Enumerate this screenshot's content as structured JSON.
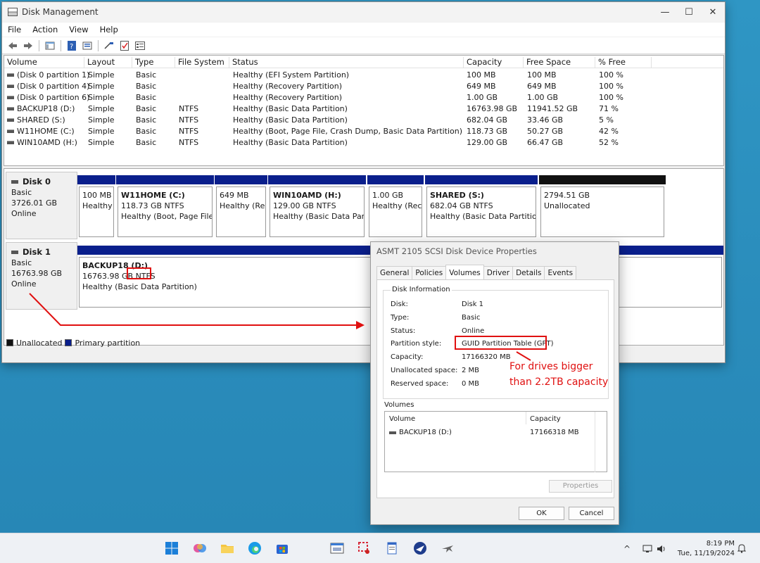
{
  "window": {
    "title": "Disk Management",
    "controls": {
      "minimize": "—",
      "maximize": "☐",
      "close": "✕"
    }
  },
  "menu": [
    "File",
    "Action",
    "View",
    "Help"
  ],
  "toolbar_icons": [
    "back-arrow-icon",
    "forward-arrow-icon",
    "console-tree-icon",
    "help-icon",
    "properties-icon",
    "checklist-icon",
    "details-icon"
  ],
  "volume_list": {
    "headers": [
      "Volume",
      "Layout",
      "Type",
      "File System",
      "Status",
      "Capacity",
      "Free Space",
      "% Free"
    ],
    "rows": [
      [
        "(Disk 0 partition 1)",
        "Simple",
        "Basic",
        "",
        "Healthy (EFI System Partition)",
        "100 MB",
        "100 MB",
        "100 %"
      ],
      [
        "(Disk 0 partition 4)",
        "Simple",
        "Basic",
        "",
        "Healthy (Recovery Partition)",
        "649 MB",
        "649 MB",
        "100 %"
      ],
      [
        "(Disk 0 partition 6)",
        "Simple",
        "Basic",
        "",
        "Healthy (Recovery Partition)",
        "1.00 GB",
        "1.00 GB",
        "100 %"
      ],
      [
        "BACKUP18 (D:)",
        "Simple",
        "Basic",
        "NTFS",
        "Healthy (Basic Data Partition)",
        "16763.98 GB",
        "11941.52 GB",
        "71 %"
      ],
      [
        "SHARED (S:)",
        "Simple",
        "Basic",
        "NTFS",
        "Healthy (Basic Data Partition)",
        "682.04 GB",
        "33.46 GB",
        "5 %"
      ],
      [
        "W11HOME (C:)",
        "Simple",
        "Basic",
        "NTFS",
        "Healthy (Boot, Page File, Crash Dump, Basic Data Partition)",
        "118.73 GB",
        "50.27 GB",
        "42 %"
      ],
      [
        "WIN10AMD (H:)",
        "Simple",
        "Basic",
        "NTFS",
        "Healthy (Basic Data Partition)",
        "129.00 GB",
        "66.47 GB",
        "52 %"
      ]
    ]
  },
  "disk0": {
    "name": "Disk 0",
    "type": "Basic",
    "size": "3726.01 GB",
    "status": "Online",
    "partitions": [
      {
        "name": "",
        "size": "100 MB",
        "status": "Healthy"
      },
      {
        "name": "W11HOME  (C:)",
        "size": "118.73 GB NTFS",
        "status": "Healthy (Boot, Page File,"
      },
      {
        "name": "",
        "size": "649 MB",
        "status": "Healthy (Rec"
      },
      {
        "name": "WIN10AMD  (H:)",
        "size": "129.00 GB NTFS",
        "status": "Healthy (Basic Data Parti"
      },
      {
        "name": "",
        "size": "1.00 GB",
        "status": "Healthy (Recc"
      },
      {
        "name": "SHARED  (S:)",
        "size": "682.04 GB NTFS",
        "status": "Healthy (Basic Data Partition)"
      },
      {
        "name": "",
        "size": "2794.51 GB",
        "status": "Unallocated"
      }
    ]
  },
  "disk1": {
    "name": "Disk 1",
    "type": "Basic",
    "size": "16763.98 GB",
    "status": "Online",
    "partition": {
      "name": "BACKUP18  (D:)",
      "size": "16763.98 GB ",
      "fs": "NTFS",
      "status": "Healthy (Basic Data Partition)"
    }
  },
  "legend": {
    "unallocated": "Unallocated",
    "primary": "Primary partition",
    "unallocated_color": "#111111",
    "primary_color": "#0a1f8c"
  },
  "dialog": {
    "title": "ASMT 2105 SCSI Disk Device Properties",
    "tabs": [
      "General",
      "Policies",
      "Volumes",
      "Driver",
      "Details",
      "Events"
    ],
    "active_tab": "Volumes",
    "group_title": "Disk Information",
    "info": [
      {
        "label": "Disk:",
        "value": "Disk 1"
      },
      {
        "label": "Type:",
        "value": "Basic"
      },
      {
        "label": "Status:",
        "value": "Online"
      },
      {
        "label": "Partition style:",
        "value": "GUID Partition Table (GPT)"
      },
      {
        "label": "Capacity:",
        "value": "17166320 MB"
      },
      {
        "label": "Unallocated space:",
        "value": "2 MB"
      },
      {
        "label": "Reserved space:",
        "value": "0 MB"
      }
    ],
    "volumes_title": "Volumes",
    "volumes_headers": [
      "Volume",
      "Capacity"
    ],
    "volumes_row": {
      "volume": "BACKUP18 (D:)",
      "capacity": "17166318 MB"
    },
    "properties_button": "Properties",
    "ok": "OK",
    "cancel": "Cancel"
  },
  "annotation": {
    "line1": "For drives bigger",
    "line2": "than 2.2TB capacity",
    "color": "#e01010"
  },
  "taskbar": {
    "icons": [
      "windows-start-icon",
      "copilot-icon",
      "file-explorer-icon",
      "edge-icon",
      "store-icon",
      "disk-tool-icon",
      "snipping-tool-icon",
      "notepad-icon",
      "app-icon",
      "plane-app-icon"
    ],
    "time": "8:19 PM",
    "date": "Tue, 11/19/2024",
    "tray": {
      "chevron": "^",
      "network": "▭",
      "volume": "🔈",
      "notifications": "🔔"
    }
  }
}
